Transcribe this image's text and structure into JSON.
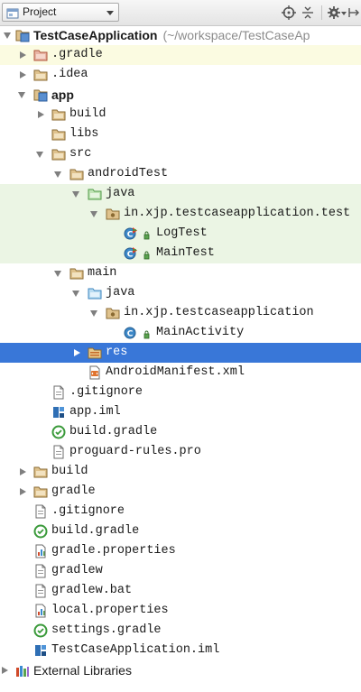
{
  "toolbar": {
    "view_label": "Project",
    "icons": [
      "project-icon",
      "target-icon",
      "collapse-all-icon",
      "gear-icon",
      "hide-icon"
    ]
  },
  "tree": {
    "root": {
      "label": "TestCaseApplication",
      "path": "(~/workspace/TestCaseAp"
    },
    "gradle_hidden": ".gradle",
    "idea": ".idea",
    "app": "app",
    "app_build": "build",
    "libs": "libs",
    "src": "src",
    "android_test": "androidTest",
    "android_test_java": "java",
    "test_package": "in.xjp.testcaseapplication.test",
    "log_test": "LogTest",
    "main_test": "MainTest",
    "main": "main",
    "main_java": "java",
    "main_package": "in.xjp.testcaseapplication",
    "main_activity": "MainActivity",
    "res": "res",
    "manifest": "AndroidManifest.xml",
    "app_gitignore": ".gitignore",
    "app_iml": "app.iml",
    "app_build_gradle": "build.gradle",
    "proguard": "proguard-rules.pro",
    "root_build": "build",
    "root_gradle": "gradle",
    "root_gitignore": ".gitignore",
    "root_build_gradle": "build.gradle",
    "gradle_properties": "gradle.properties",
    "gradlew": "gradlew",
    "gradlew_bat": "gradlew.bat",
    "local_properties": "local.properties",
    "settings_gradle": "settings.gradle",
    "root_iml": "TestCaseApplication.iml",
    "external_libraries": "External Libraries"
  },
  "colors": {
    "selection": "#3977d8",
    "highlight_yellow": "#fbfbe1",
    "highlight_green": "#ebf5e4",
    "folder": "#c8a86e",
    "source_folder": "#72b8e0",
    "test_folder": "#6cb26a"
  }
}
